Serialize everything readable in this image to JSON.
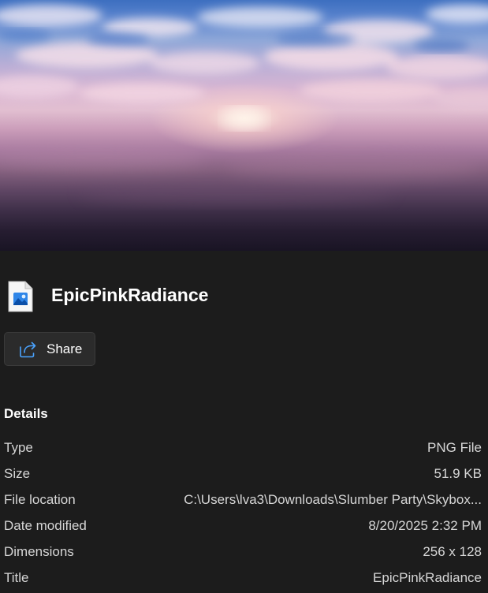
{
  "file": {
    "name": "EpicPinkRadiance",
    "icon": "image-file-icon"
  },
  "actions": {
    "share_label": "Share",
    "share_icon": "share-icon"
  },
  "details": {
    "heading": "Details",
    "rows": [
      {
        "label": "Type",
        "value": "PNG File"
      },
      {
        "label": "Size",
        "value": "51.9 KB"
      },
      {
        "label": "File location",
        "value": "C:\\Users\\lva3\\Downloads\\Slumber Party\\Skybox..."
      },
      {
        "label": "Date modified",
        "value": "8/20/2025 2:32 PM"
      },
      {
        "label": "Dimensions",
        "value": "256 x 128"
      },
      {
        "label": "Title",
        "value": "EpicPinkRadiance"
      }
    ]
  },
  "colors": {
    "background": "#1c1c1c",
    "button_background": "#2b2b2b",
    "text_primary": "#ffffff",
    "text_secondary": "#d6d6d6",
    "icon_accent": "#4aa3ff"
  }
}
